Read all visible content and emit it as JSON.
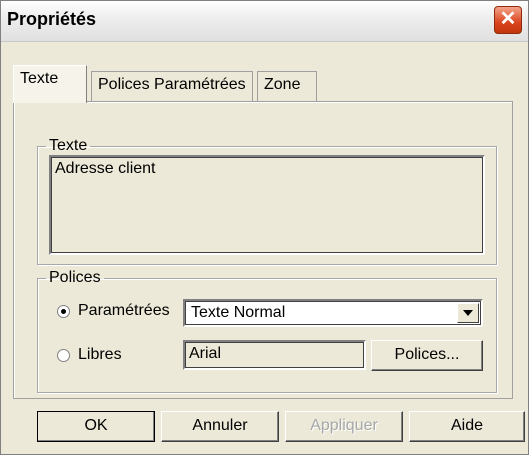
{
  "window": {
    "title": "Propriétés",
    "close_glyph": "✕"
  },
  "tabs": [
    {
      "label": "Texte",
      "active": true
    },
    {
      "label": "Polices Paramétrées",
      "active": false
    },
    {
      "label": "Zone",
      "active": false
    }
  ],
  "text_group": {
    "legend": "Texte",
    "value": "Adresse client"
  },
  "fonts_group": {
    "legend": "Polices",
    "parametrees": {
      "label": "Paramétrées",
      "checked": true,
      "selected": "Texte Normal"
    },
    "libres": {
      "label": "Libres",
      "checked": false,
      "font_value": "Arial",
      "button_label": "Polices..."
    }
  },
  "footer": {
    "ok": "OK",
    "cancel": "Annuler",
    "apply": "Appliquer",
    "help": "Aide"
  }
}
